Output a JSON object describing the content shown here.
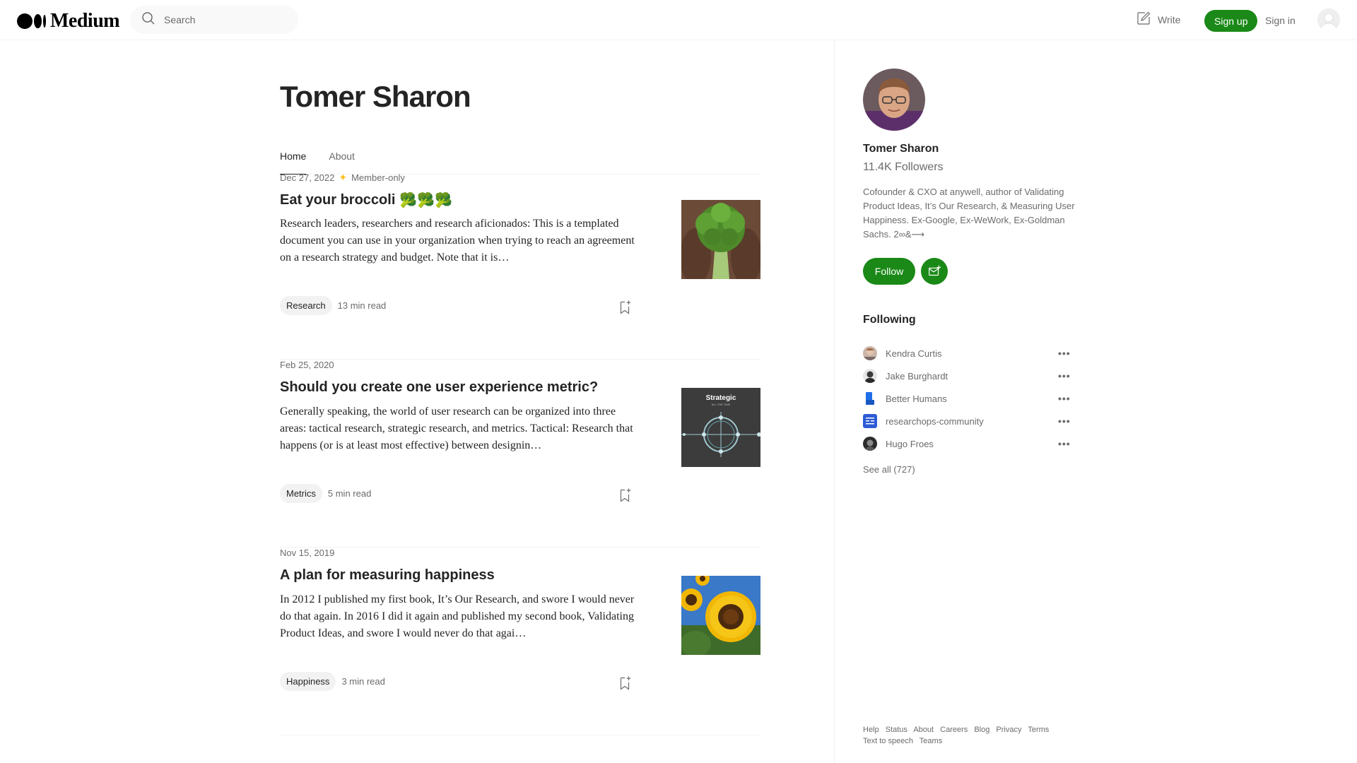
{
  "header": {
    "logo_text": "Medium",
    "search_placeholder": "Search",
    "write_label": "Write",
    "signup_label": "Sign up",
    "signin_label": "Sign in"
  },
  "main": {
    "author_name": "Tomer Sharon",
    "tabs": [
      {
        "label": "Home",
        "active": true
      },
      {
        "label": "About",
        "active": false
      }
    ],
    "posts": [
      {
        "date": "Dec 27, 2022",
        "member_only_label": "Member-only",
        "title": "Eat your broccoli",
        "title_emoji": "🥦🥦🥦",
        "excerpt": "Research leaders, researchers and research aficionados: This is a templated document you can use in your organization when trying to reach an agreement on a research strategy and budget. Note that it is…",
        "tag": "Research",
        "read_time": "13 min read"
      },
      {
        "date": "Feb 25, 2020",
        "title": "Should you create one user experience metric?",
        "excerpt": "Generally speaking, the world of user research can be organized into three areas: tactical research, strategic research, and metrics. Tactical: Research that happens (or is at least most effective) between designin…",
        "tag": "Metrics",
        "read_time": "5 min read",
        "thumb_text": "Strategic",
        "thumb_subtext": "ALL THE TIME"
      },
      {
        "date": "Nov 15, 2019",
        "title": "A plan for measuring happiness",
        "excerpt": "In 2012 I published my first book, It’s Our Research, and swore I would never do that again. In 2016 I did it again and published my second book, Validating Product Ideas, and swore I would never do that agai…",
        "tag": "Happiness",
        "read_time": "3 min read"
      }
    ]
  },
  "sidebar": {
    "name": "Tomer Sharon",
    "followers": "11.4K Followers",
    "bio": "Cofounder & CXO at anywell, author of Validating Product Ideas, It’s Our Research, & Measuring User Happiness. Ex-Google, Ex-WeWork, Ex-Goldman Sachs. 2∞&⟶",
    "follow_label": "Follow",
    "following_title": "Following",
    "following": [
      {
        "name": "Kendra Curtis",
        "more": "•••"
      },
      {
        "name": "Jake Burghardt",
        "more": "•••"
      },
      {
        "name": "Better Humans",
        "more": "•••"
      },
      {
        "name": "researchops-community",
        "more": "•••"
      },
      {
        "name": "Hugo Froes",
        "more": "•••"
      }
    ],
    "see_all": "See all (727)",
    "footer_links": [
      "Help",
      "Status",
      "About",
      "Careers",
      "Blog",
      "Privacy",
      "Terms",
      "Text to speech",
      "Teams"
    ]
  },
  "colors": {
    "accent_green": "#1a8917",
    "member_star": "#ffc017",
    "text_primary": "#242424",
    "text_secondary": "#6b6b6b"
  }
}
